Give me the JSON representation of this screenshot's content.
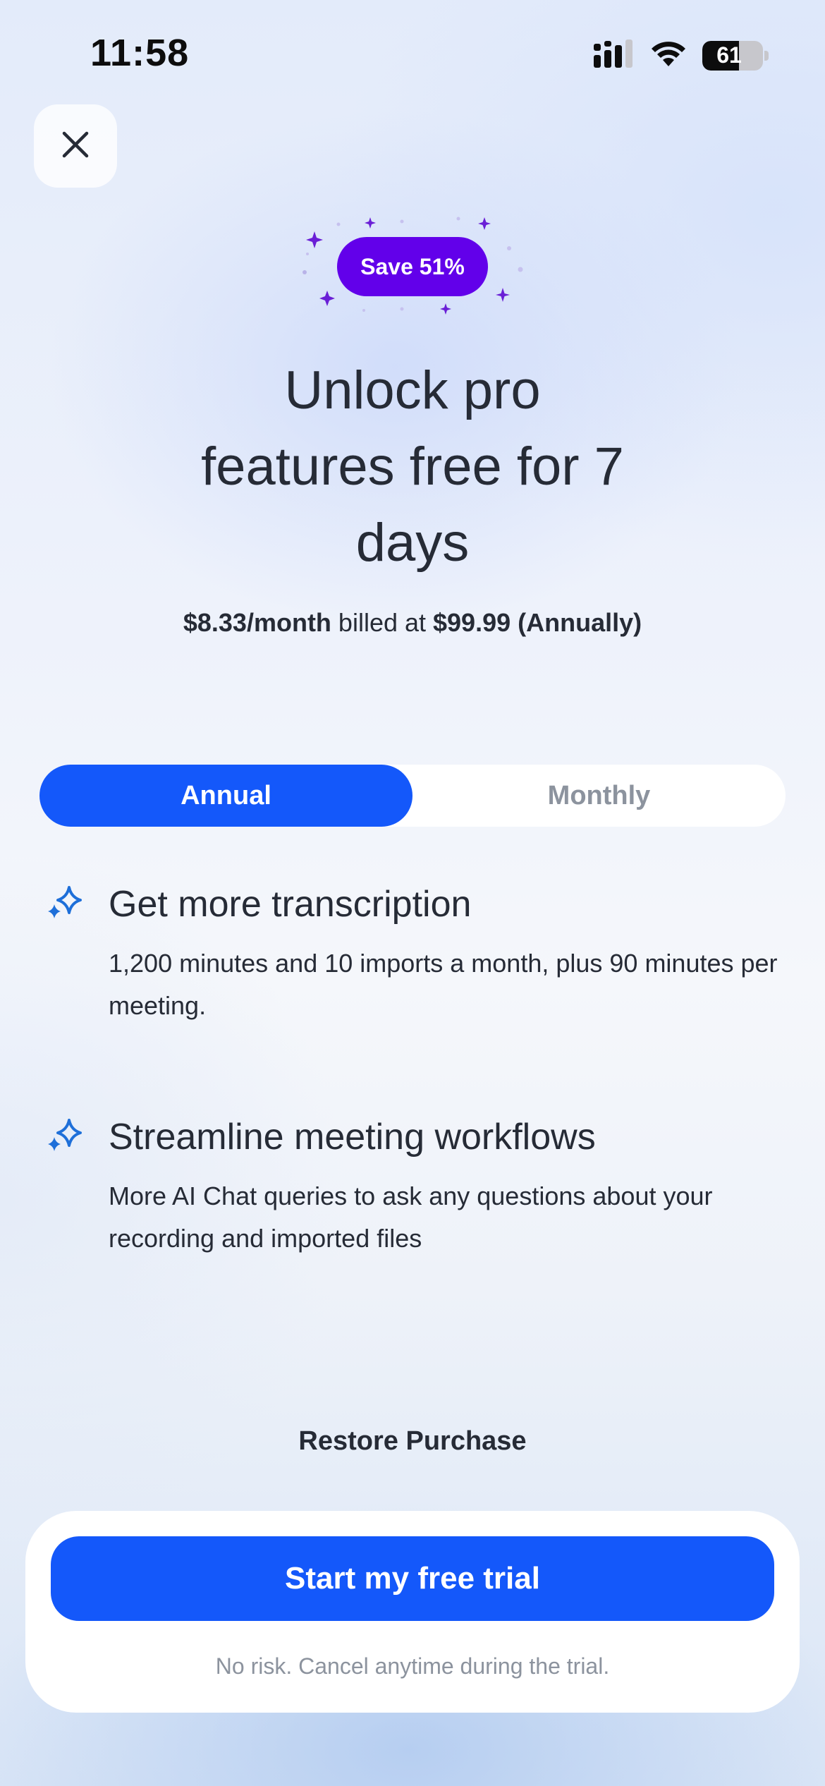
{
  "status_bar": {
    "time": "11:58",
    "battery": "61",
    "battery_level_percent": 61,
    "icons": [
      "cellular-signal-icon",
      "wifi-icon",
      "battery-icon"
    ]
  },
  "close_button": {
    "icon": "close-icon"
  },
  "badge": {
    "label": "Save 51%"
  },
  "headline": {
    "line1": "Unlock pro",
    "line2": "features free for 7",
    "line3": "days"
  },
  "pricing": {
    "monthly_price": "$8.33/month",
    "billed_text": " billed at ",
    "annual_price": "$99.99 (Annually)"
  },
  "plan_toggle": {
    "options": [
      {
        "label": "Annual",
        "selected": true
      },
      {
        "label": "Monthly",
        "selected": false
      }
    ]
  },
  "features": [
    {
      "icon": "sparkle-icon",
      "title": "Get more transcription",
      "description": "1,200 minutes and 10 imports a month, plus 90 minutes per meeting."
    },
    {
      "icon": "sparkle-icon",
      "title": "Streamline meeting workflows",
      "description": "More AI Chat queries to ask any questions about your recording and imported files"
    }
  ],
  "restore": {
    "label": "Restore Purchase"
  },
  "cta": {
    "label": "Start my free trial",
    "note": "No risk. Cancel anytime during the trial."
  },
  "colors": {
    "accent": "#1458fa",
    "badge": "#6200ea",
    "text": "#262b36",
    "muted": "#8c939e",
    "sparkle": "#1e6fd9"
  }
}
